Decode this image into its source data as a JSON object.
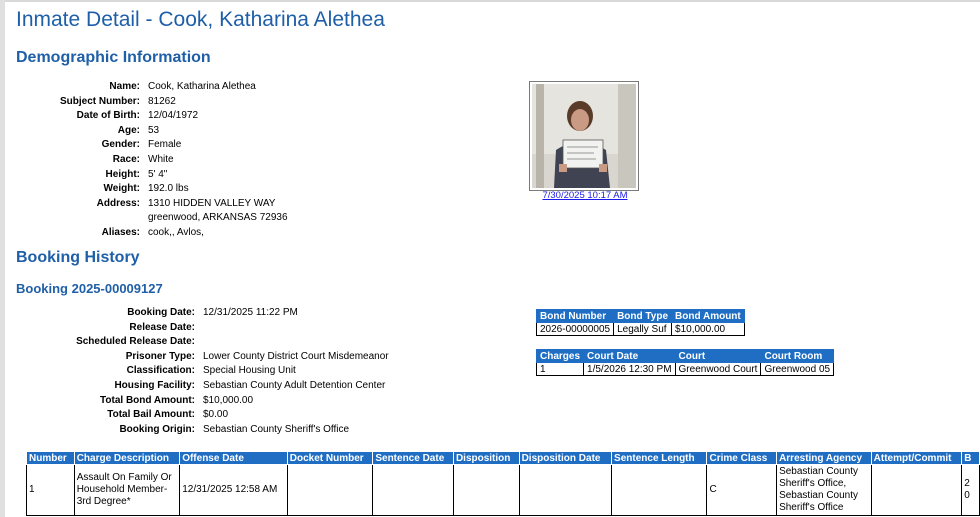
{
  "page": {
    "title": "Inmate Detail - Cook, Katharina Alethea"
  },
  "demographic": {
    "heading": "Demographic Information",
    "fields": [
      {
        "label": "Name:",
        "value": "Cook, Katharina Alethea"
      },
      {
        "label": "Subject Number:",
        "value": "81262"
      },
      {
        "label": "Date of Birth:",
        "value": "12/04/1972"
      },
      {
        "label": "Age:",
        "value": "53"
      },
      {
        "label": "Gender:",
        "value": "Female"
      },
      {
        "label": "Race:",
        "value": "White"
      },
      {
        "label": "Height:",
        "value": "5' 4\""
      },
      {
        "label": "Weight:",
        "value": "192.0 lbs"
      },
      {
        "label": "Address:",
        "value": "1310 HIDDEN VALLEY WAY",
        "value2": "greenwood, ARKANSAS 72936"
      },
      {
        "label": "Aliases:",
        "value": "cook,, Avlos,"
      }
    ],
    "photo_date": "7/30/2025 10:17 AM"
  },
  "booking_history": {
    "heading": "Booking History",
    "booking_title": "Booking 2025-00009127",
    "fields": [
      {
        "label": "Booking Date:",
        "value": "12/31/2025 11:22 PM"
      },
      {
        "label": "Release Date:",
        "value": ""
      },
      {
        "label": "Scheduled Release Date:",
        "value": ""
      },
      {
        "label": "Prisoner Type:",
        "value": "Lower County District Court Misdemeanor"
      },
      {
        "label": "Classification:",
        "value": "Special Housing Unit"
      },
      {
        "label": "Housing Facility:",
        "value": "Sebastian County Adult Detention Center"
      },
      {
        "label": "Total Bond Amount:",
        "value": "$10,000.00"
      },
      {
        "label": "Total Bail Amount:",
        "value": "$0.00"
      },
      {
        "label": "Booking Origin:",
        "value": "Sebastian County Sheriff's Office"
      }
    ],
    "bond_table": {
      "headers": [
        "Bond Number",
        "Bond Type",
        "Bond Amount"
      ],
      "rows": [
        [
          "2026-00000005",
          "Legally Suf",
          "$10,000.00"
        ]
      ]
    },
    "court_table": {
      "headers": [
        "Charges",
        "Court Date",
        "Court",
        "Court Room"
      ],
      "rows": [
        [
          "1",
          "1/5/2026 12:30 PM",
          "Greenwood Court",
          "Greenwood 05"
        ]
      ]
    },
    "charges_table": {
      "headers": [
        "Number",
        "Charge Description",
        "Offense Date",
        "Docket Number",
        "Sentence Date",
        "Disposition",
        "Disposition Date",
        "Sentence Length",
        "Crime Class",
        "Arresting Agency",
        "Attempt/Commit",
        "B"
      ],
      "rows": [
        [
          "1",
          "Assault On Family Or Household Member-3rd Degree*",
          "12/31/2025 12:58 AM",
          "",
          "",
          "",
          "",
          "",
          "C",
          "Sebastian County Sheriff's Office, Sebastian County Sheriff's Office",
          "",
          "2\n0"
        ]
      ]
    }
  }
}
